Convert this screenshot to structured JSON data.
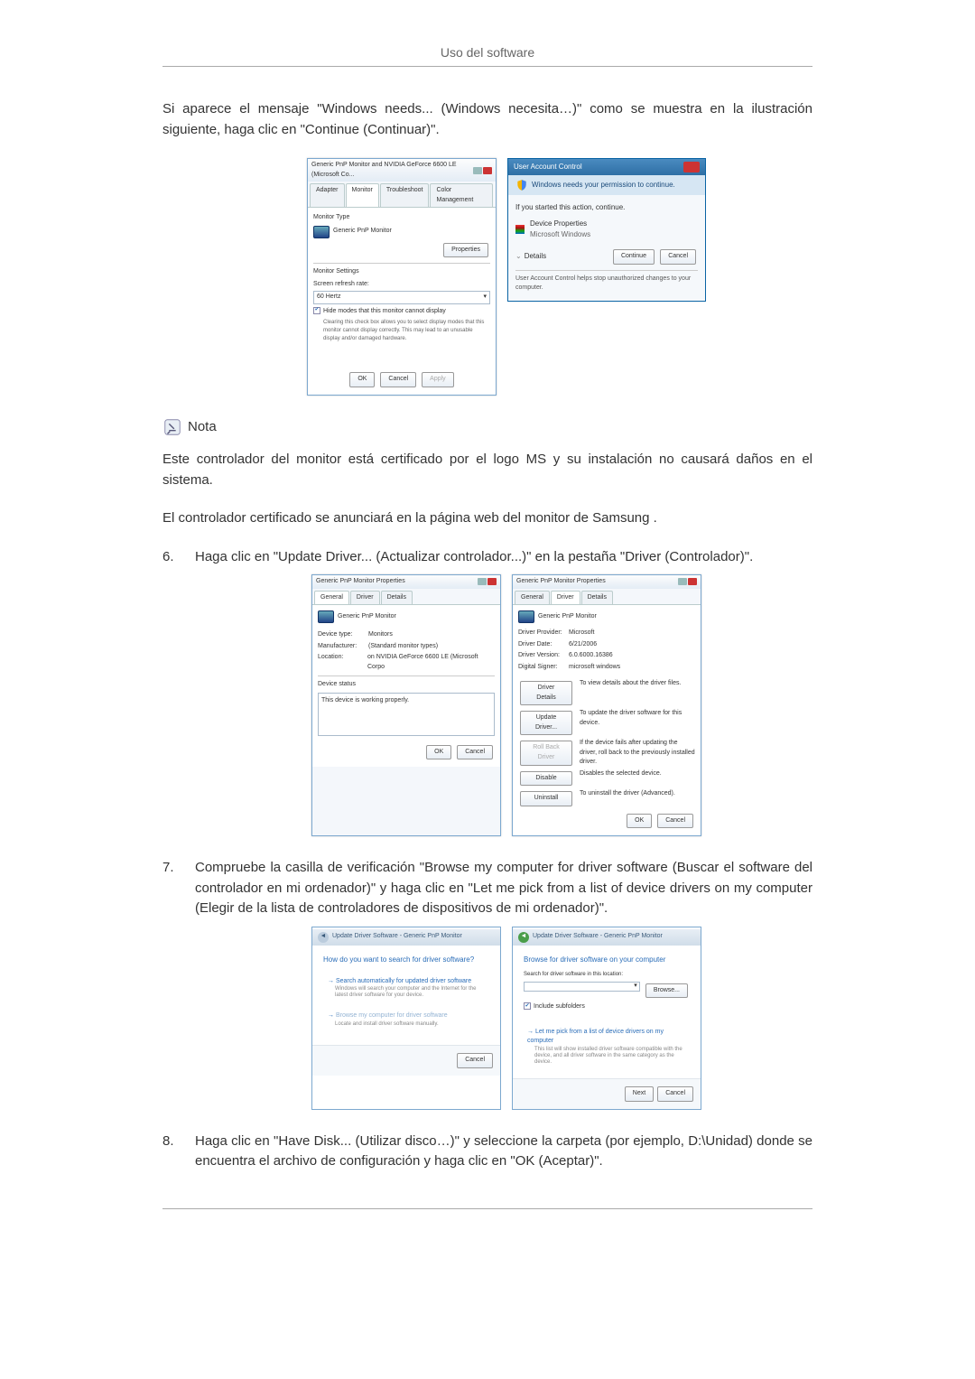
{
  "header": {
    "title": "Uso del software"
  },
  "intro_text": "Si aparece el mensaje \"Windows needs... (Windows necesita…)\" como se muestra en la ilustración siguiente, haga clic en \"Continue (Continuar)\".",
  "monitor_props": {
    "title": "Generic PnP Monitor and NVIDIA GeForce 6600 LE (Microsoft Co...",
    "tab_adapter": "Adapter",
    "tab_monitor": "Monitor",
    "tab_troubleshoot": "Troubleshoot",
    "tab_color": "Color Management",
    "monitor_type_label": "Monitor Type",
    "monitor_type_value": "Generic PnP Monitor",
    "properties_btn": "Properties",
    "monitor_settings_label": "Monitor Settings",
    "refresh_label": "Screen refresh rate:",
    "refresh_value": "60 Hertz",
    "hide_modes": "Hide modes that this monitor cannot display",
    "hide_desc": "Clearing this check box allows you to select display modes that this monitor cannot display correctly. This may lead to an unusable display and/or damaged hardware.",
    "ok": "OK",
    "cancel": "Cancel",
    "apply": "Apply"
  },
  "uac": {
    "title": "User Account Control",
    "banner": "Windows needs your permission to continue.",
    "started": "If you started this action, continue.",
    "device_props": "Device Properties",
    "ms_windows": "Microsoft Windows",
    "details": "Details",
    "continue": "Continue",
    "cancel": "Cancel",
    "footer": "User Account Control helps stop unauthorized changes to your computer."
  },
  "note": {
    "label": "Nota",
    "p1": "Este controlador del monitor está certificado por el logo MS y su instalación no causará daños en el sistema.",
    "p2": "El controlador certificado se anunciará en la página web del monitor de Samsung ."
  },
  "step6": {
    "num": "6.",
    "text": "Haga clic en \"Update Driver... (Actualizar controlador...)\" en la pestaña \"Driver (Controlador)\"."
  },
  "driver_props": {
    "title": "Generic PnP Monitor Properties",
    "tab_general": "General",
    "tab_driver": "Driver",
    "tab_details": "Details",
    "name": "Generic PnP Monitor",
    "device_type_l": "Device type:",
    "device_type_v": "Monitors",
    "manufacturer_l": "Manufacturer:",
    "manufacturer_v": "(Standard monitor types)",
    "location_l": "Location:",
    "location_v": "on NVIDIA GeForce 6600 LE (Microsoft Corpo",
    "device_status_l": "Device status",
    "device_status_v": "This device is working properly.",
    "ok": "OK",
    "cancel": "Cancel"
  },
  "driver_tab": {
    "provider_l": "Driver Provider:",
    "provider_v": "Microsoft",
    "date_l": "Driver Date:",
    "date_v": "6/21/2006",
    "version_l": "Driver Version:",
    "version_v": "6.0.6000.16386",
    "signer_l": "Digital Signer:",
    "signer_v": "microsoft windows",
    "details_btn": "Driver Details",
    "details_desc": "To view details about the driver files.",
    "update_btn": "Update Driver...",
    "update_desc": "To update the driver software for this device.",
    "rollback_btn": "Roll Back Driver",
    "rollback_desc": "If the device fails after updating the driver, roll back to the previously installed driver.",
    "disable_btn": "Disable",
    "disable_desc": "Disables the selected device.",
    "uninstall_btn": "Uninstall",
    "uninstall_desc": "To uninstall the driver (Advanced).",
    "ok": "OK",
    "cancel": "Cancel"
  },
  "step7": {
    "num": "7.",
    "text": "Compruebe la casilla de verificación \"Browse my computer for driver software (Buscar el software del controlador en mi ordenador)\" y haga clic en \"Let me pick from a list of device drivers on my computer (Elegir de la lista de controladores de dispositivos de mi ordenador)\"."
  },
  "wizard1": {
    "top": "Update Driver Software - Generic PnP Monitor",
    "heading": "How do you want to search for driver software?",
    "opt1": "Search automatically for updated driver software",
    "opt1_sub": "Windows will search your computer and the Internet for the latest driver software for your device.",
    "opt2": "Browse my computer for driver software",
    "opt2_sub": "Locate and install driver software manually.",
    "cancel": "Cancel"
  },
  "wizard2": {
    "top": "Update Driver Software - Generic PnP Monitor",
    "heading": "Browse for driver software on your computer",
    "search_label": "Search for driver software in this location:",
    "browse": "Browse...",
    "include": "Include subfolders",
    "opt": "Let me pick from a list of device drivers on my computer",
    "opt_sub": "This list will show installed driver software compatible with the device, and all driver software in the same category as the device.",
    "next": "Next",
    "cancel": "Cancel"
  },
  "step8": {
    "num": "8.",
    "text": "Haga clic en \"Have Disk... (Utilizar disco…)\" y seleccione la carpeta (por ejemplo, D:\\Unidad) donde se encuentra el archivo de configuración y haga clic en \"OK (Aceptar)\"."
  }
}
